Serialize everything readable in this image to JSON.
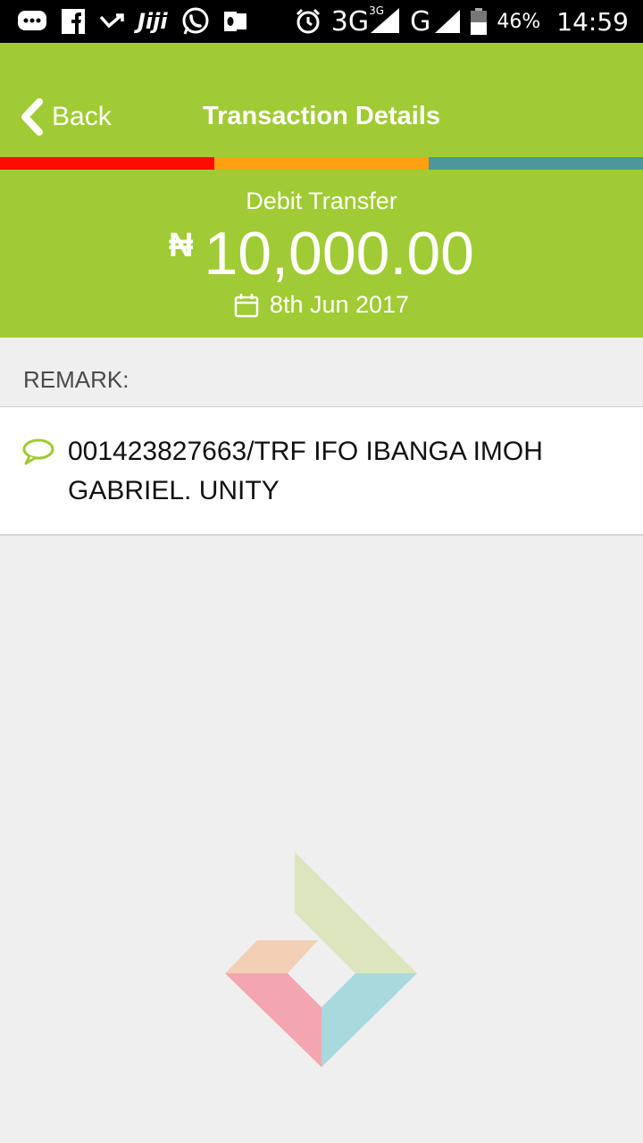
{
  "status_bar": {
    "app_label_jiji": "Jiji",
    "network": "3G",
    "network_small": "3G",
    "network_g": "G",
    "battery": "46%",
    "time": "14:59"
  },
  "header": {
    "back_label": "Back",
    "title": "Transaction Details"
  },
  "colors": {
    "primary": "#a0cb34",
    "stripe": [
      "#ff0c00",
      "#ffa012",
      "#4d9699"
    ],
    "logo": [
      "#dce5be",
      "#f2cfb5",
      "#f3a6b0",
      "#a9d8dd"
    ]
  },
  "transaction": {
    "type": "Debit Transfer",
    "currency_symbol": "₦",
    "amount": "10,000.00",
    "date": "8th Jun 2017"
  },
  "remark": {
    "header": "REMARK:",
    "text": "001423827663/TRF IFO IBANGA IMOH GABRIEL. UNITY"
  },
  "icons": [
    "message-icon",
    "facebook-icon",
    "missed-call-icon",
    "whatsapp-icon",
    "outlook-icon",
    "alarm-icon",
    "signal-icon",
    "battery-icon",
    "chevron-left-icon",
    "calendar-icon",
    "chat-bubble-icon",
    "bank-logo-icon"
  ]
}
